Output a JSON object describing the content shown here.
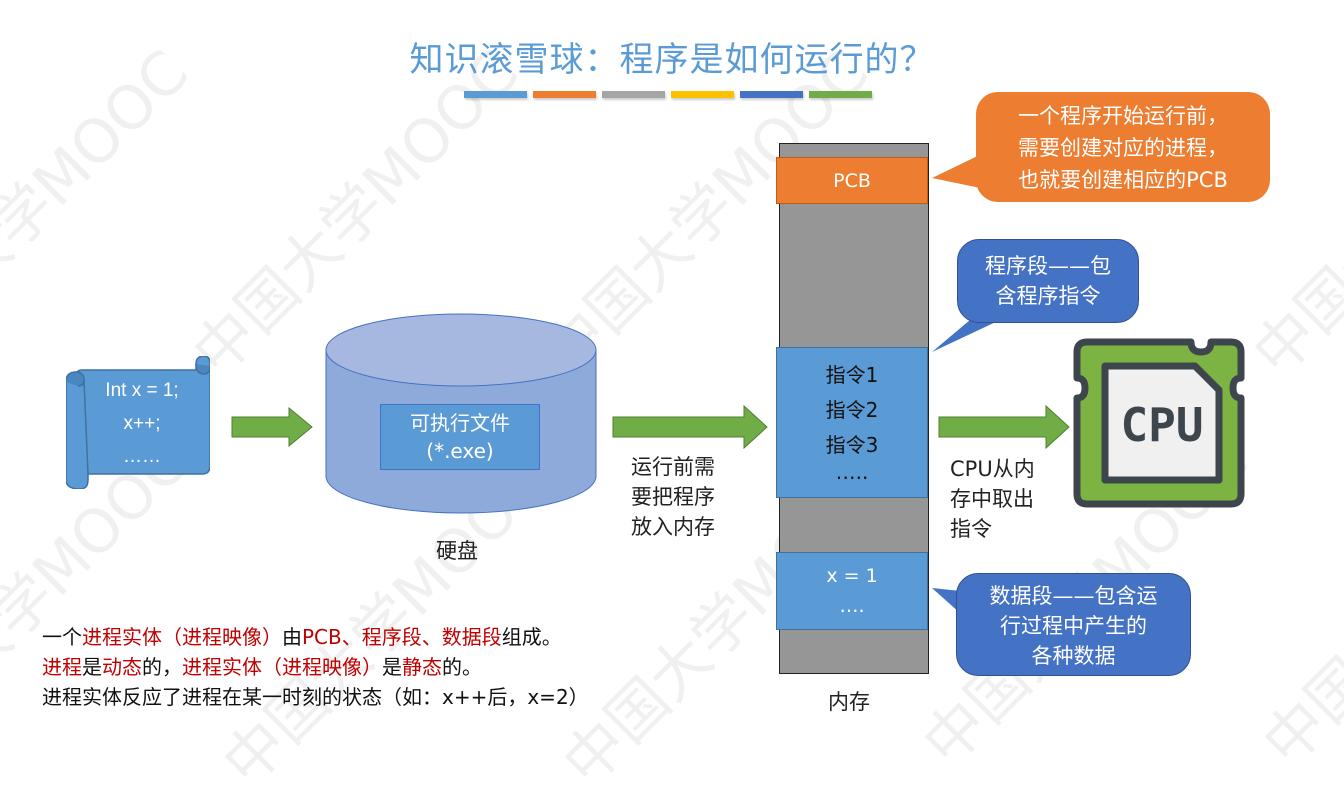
{
  "title": "知识滚雪球：程序是如何运行的？",
  "title_bar_colors": [
    "#5b9bd5",
    "#ed7d31",
    "#a5a5a5",
    "#ffc000",
    "#4472c4",
    "#70ad47"
  ],
  "watermark": "中国大学MOOC",
  "source_code": {
    "lines": [
      "Int x = 1;",
      "x++;",
      "……"
    ]
  },
  "disk": {
    "file_label_line1": "可执行文件",
    "file_label_line2": "(*.exe)",
    "caption": "硬盘"
  },
  "load_arrow_caption": [
    "运行前需",
    "要把程序",
    "放入内存"
  ],
  "memory": {
    "caption": "内存",
    "pcb_label": "PCB",
    "code_segment": [
      "指令1",
      "指令2",
      "指令3",
      "….."
    ],
    "data_segment": [
      "x = 1",
      "…."
    ]
  },
  "fetch_arrow_caption": [
    "CPU从内",
    "存中取出",
    "指令"
  ],
  "cpu_icon_label": "CPU",
  "callouts": {
    "pcb": [
      "一个程序开始运行前，",
      "需要创建对应的进程，",
      "也就要创建相应的PCB"
    ],
    "code": [
      "程序段——包",
      "含程序指令"
    ],
    "data": [
      "数据段——包含运",
      "行过程中产生的",
      "各种数据"
    ]
  },
  "notes": {
    "line1": [
      {
        "text": "一个",
        "red": false
      },
      {
        "text": "进程实体（进程映像）",
        "red": true
      },
      {
        "text": "由",
        "red": false
      },
      {
        "text": "PCB、程序段、数据段",
        "red": true
      },
      {
        "text": "组成。",
        "red": false
      }
    ],
    "line2": [
      {
        "text": "进程",
        "red": true
      },
      {
        "text": "是",
        "red": false
      },
      {
        "text": "动态",
        "red": true
      },
      {
        "text": "的，",
        "red": false
      },
      {
        "text": "进程实体（进程映像）",
        "red": true
      },
      {
        "text": "是",
        "red": false
      },
      {
        "text": "静态",
        "red": true
      },
      {
        "text": "的。",
        "red": false
      }
    ],
    "line3": [
      {
        "text": "进程实体反应了进程在某一时刻的状态（如：x++后，x=2）",
        "red": false
      }
    ]
  }
}
